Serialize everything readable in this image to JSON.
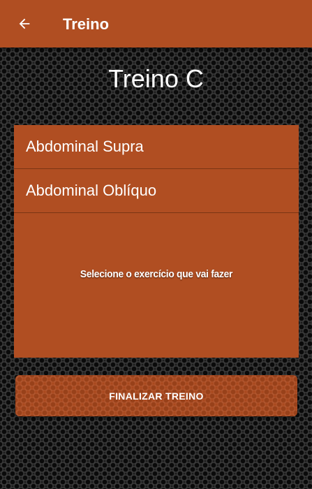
{
  "app_bar": {
    "back_icon": "arrow-left-icon",
    "title": "Treino",
    "color": "#b04e22"
  },
  "main": {
    "heading": "Treino C",
    "exercises": [
      {
        "label": "Abdominal Supra"
      },
      {
        "label": "Abdominal Oblíquo"
      }
    ],
    "hint": "Selecione o exercício que vai fazer",
    "finish_button_label": "FINALIZAR TREINO"
  }
}
